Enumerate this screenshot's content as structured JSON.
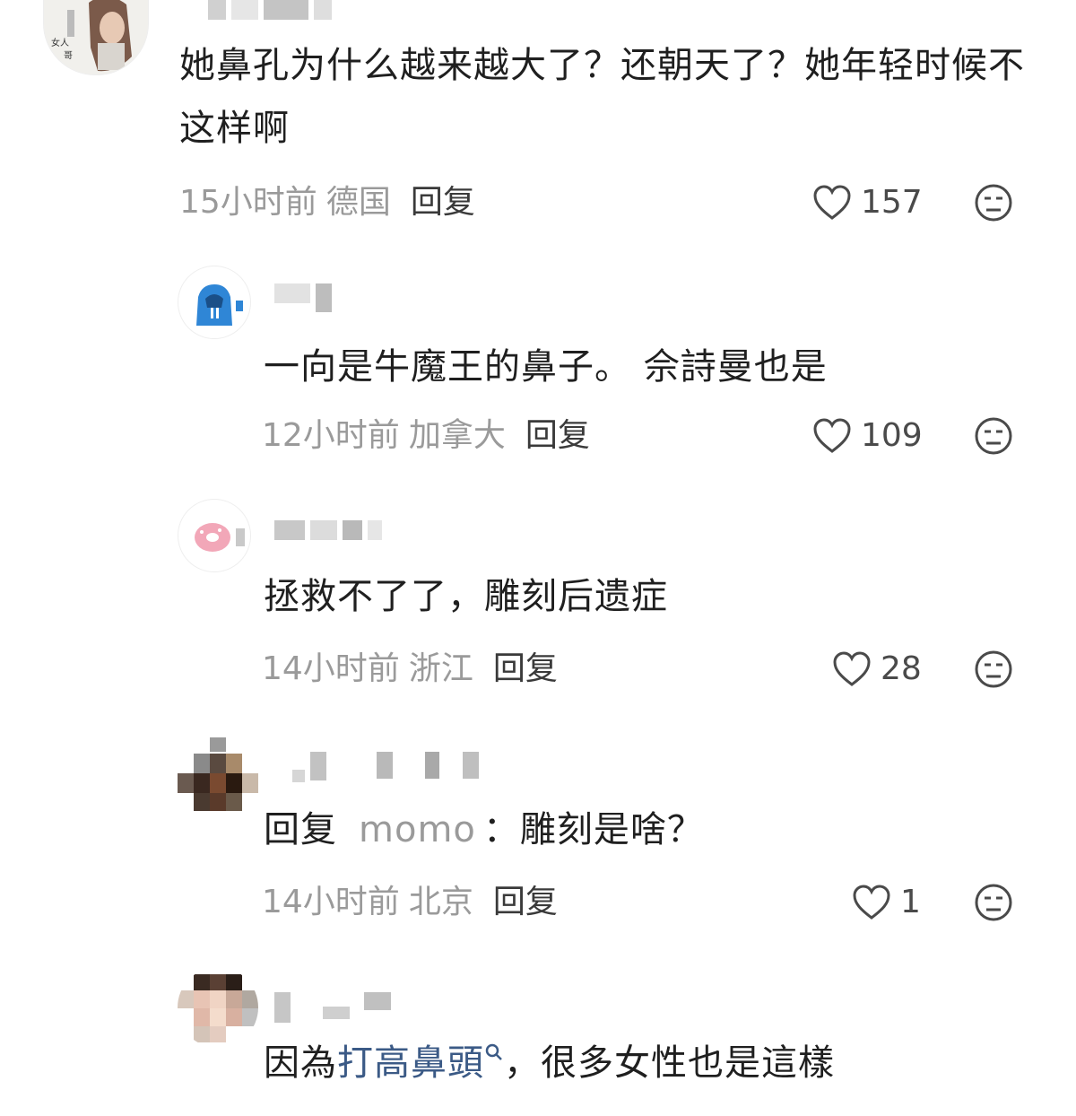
{
  "comments": [
    {
      "text": "她鼻孔为什么越来越大了？还朝天了？她年轻时候不这样啊",
      "time": "15小时前",
      "location": "德国",
      "reply_label": "回复",
      "likes": "157"
    },
    {
      "text": "一向是牛魔王的鼻子。 佘詩曼也是",
      "time": "12小时前",
      "location": "加拿大",
      "reply_label": "回复",
      "likes": "109"
    },
    {
      "text": "拯救不了了，雕刻后遗症",
      "time": "14小时前",
      "location": "浙江",
      "reply_label": "回复",
      "likes": "28"
    },
    {
      "reply_prefix": "回复",
      "reply_to": "momo",
      "text": "：雕刻是啥？",
      "time": "14小时前",
      "location": "北京",
      "reply_label": "回复",
      "likes": "1"
    },
    {
      "text_before": "因為",
      "link_text": "打高鼻頭",
      "link_icon": "search-icon",
      "text_after": "，很多女性也是這樣"
    }
  ],
  "colors": {
    "meta_gray": "#9a9a9a",
    "link_blue": "#3b5a86",
    "icon_gray": "#4a4a4a"
  }
}
